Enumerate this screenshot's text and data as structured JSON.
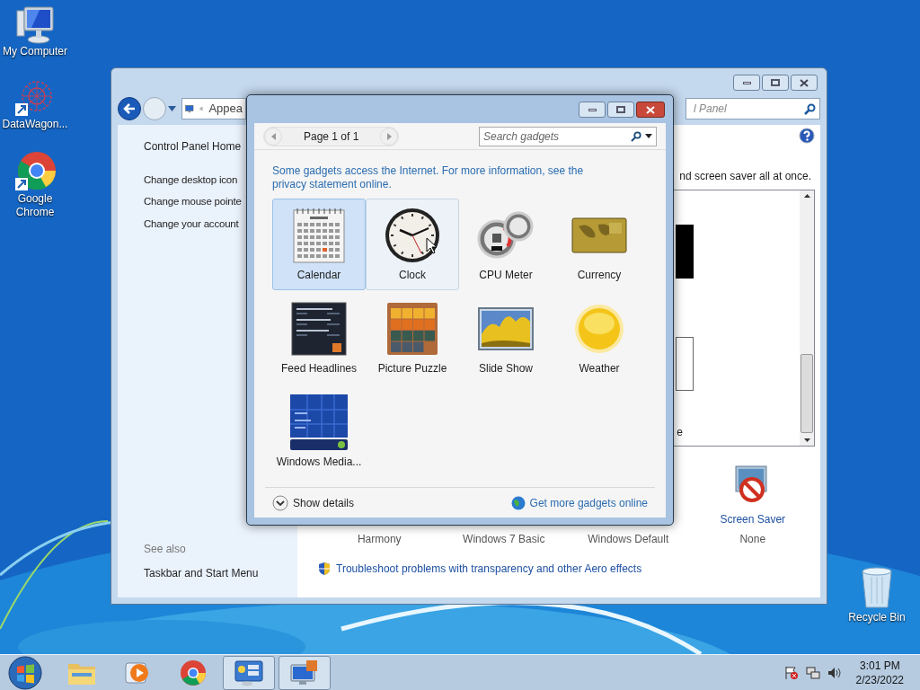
{
  "desktop_icons": [
    {
      "label": "My Computer",
      "kind": "computer"
    },
    {
      "label": "DataWagon...",
      "kind": "datawagon"
    },
    {
      "label": "Google Chrome",
      "kind": "chrome"
    }
  ],
  "recycle_bin": {
    "label": "Recycle Bin"
  },
  "control_panel": {
    "address": "Appea",
    "search_placeholder": "l Panel",
    "sidebar": {
      "home": "Control Panel Home",
      "tasks": [
        "Change desktop icon",
        "Change mouse pointe",
        "Change your account"
      ],
      "see_also_title": "See also",
      "see_also": [
        "Taskbar and Start Menu"
      ]
    },
    "intro": "nd screen saver all at once.",
    "theme_fragment": "e",
    "bottom_items": [
      {
        "label": "Harmony",
        "kind": "text"
      },
      {
        "label": "Windows 7 Basic",
        "kind": "text"
      },
      {
        "label": "Windows Default",
        "kind": "text"
      },
      {
        "label": "Screen Saver",
        "value": "None",
        "kind": "screensaver"
      }
    ],
    "troubleshoot": "Troubleshoot problems with transparency and other Aero effects"
  },
  "gadget_window": {
    "pager": "Page 1 of 1",
    "search": {
      "placeholder": "Search gadgets"
    },
    "notice": "Some gadgets access the Internet.  For more information, see the privacy statement online.",
    "gadgets": [
      {
        "name": "Calendar",
        "kind": "calendar",
        "selected": true,
        "hovered": false
      },
      {
        "name": "Clock",
        "kind": "clock",
        "selected": false,
        "hovered": true
      },
      {
        "name": "CPU Meter",
        "kind": "cpu",
        "selected": false,
        "hovered": false
      },
      {
        "name": "Currency",
        "kind": "currency",
        "selected": false,
        "hovered": false
      },
      {
        "name": "Feed Headlines",
        "kind": "feed",
        "selected": false,
        "hovered": false
      },
      {
        "name": "Picture Puzzle",
        "kind": "puzzle",
        "selected": false,
        "hovered": false
      },
      {
        "name": "Slide Show",
        "kind": "slideshow",
        "selected": false,
        "hovered": false
      },
      {
        "name": "Weather",
        "kind": "weather",
        "selected": false,
        "hovered": false
      },
      {
        "name": "Windows Media...",
        "kind": "media",
        "selected": false,
        "hovered": false
      }
    ],
    "show_details": "Show details",
    "more_link": "Get more gadgets online"
  },
  "taskbar": {
    "items": [
      {
        "kind": "explorer",
        "selected": false
      },
      {
        "kind": "player",
        "selected": false
      },
      {
        "kind": "chrome",
        "selected": false
      },
      {
        "kind": "gadgets",
        "selected": true
      },
      {
        "kind": "display",
        "selected": true
      }
    ],
    "time": "3:01 PM",
    "date": "2/23/2022"
  }
}
